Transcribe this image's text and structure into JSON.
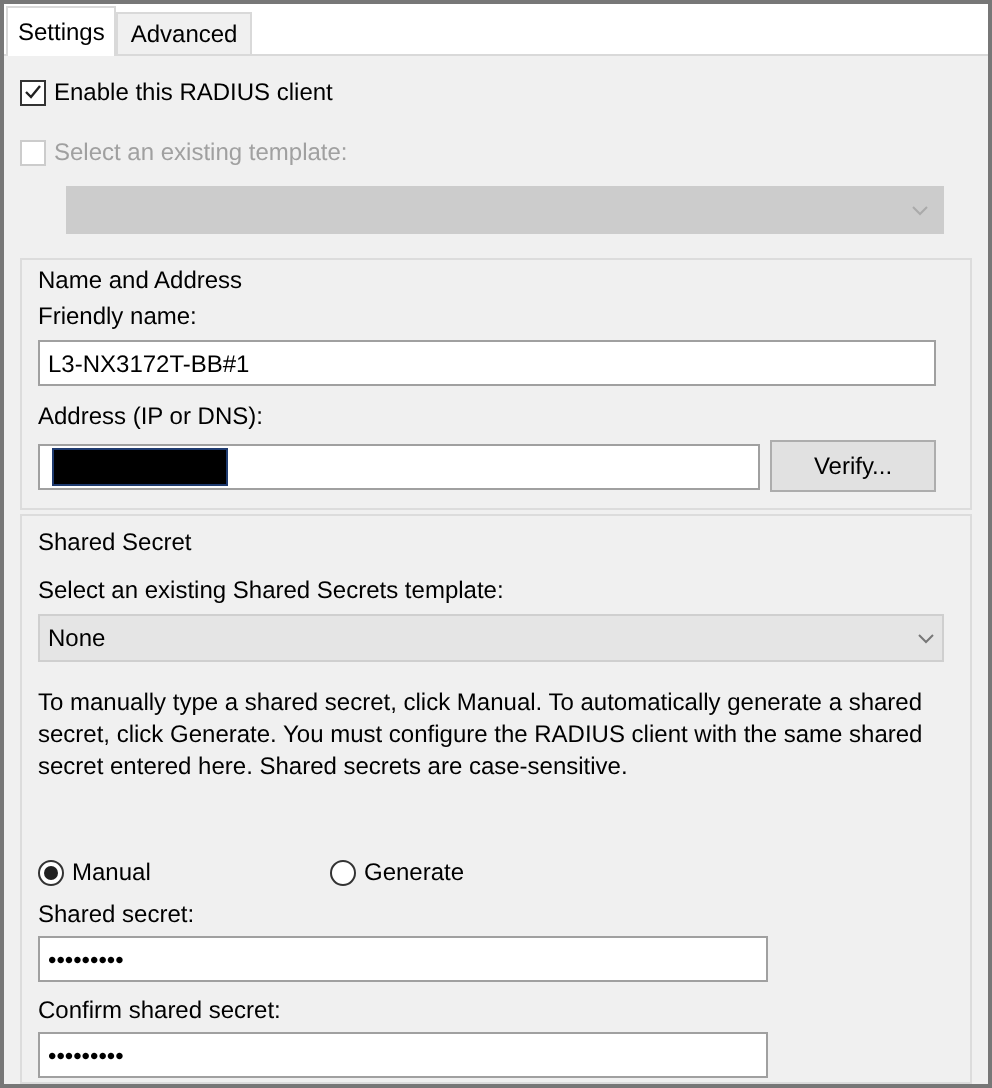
{
  "tabs": [
    {
      "label": "Settings",
      "selected": true
    },
    {
      "label": "Advanced",
      "selected": false
    }
  ],
  "enable_client": {
    "label": "Enable this RADIUS client",
    "checked": true,
    "disabled": false
  },
  "template": {
    "label": "Select an existing template:",
    "checked": false,
    "disabled": true
  },
  "name_and_address": {
    "title": "Name and Address",
    "friendly_name_label": "Friendly name:",
    "friendly_name": "L3-NX3172T-BB#1",
    "address_label": "Address (IP or DNS):",
    "verify_button": "Verify..."
  },
  "shared_secret": {
    "title": "Shared Secret",
    "template_label": "Select an existing Shared Secrets template:",
    "template_value": "None",
    "description": "To manually type a shared secret, click Manual. To automatically generate a shared secret, click Generate. You must configure the RADIUS client with the same shared secret entered here. Shared secrets are case-sensitive.",
    "options": [
      {
        "label": "Manual",
        "selected": true
      },
      {
        "label": "Generate",
        "selected": false
      }
    ],
    "secret_label": "Shared secret:",
    "secret": "•••••••••",
    "confirm_label": "Confirm shared secret:",
    "confirm": "•••••••••"
  }
}
